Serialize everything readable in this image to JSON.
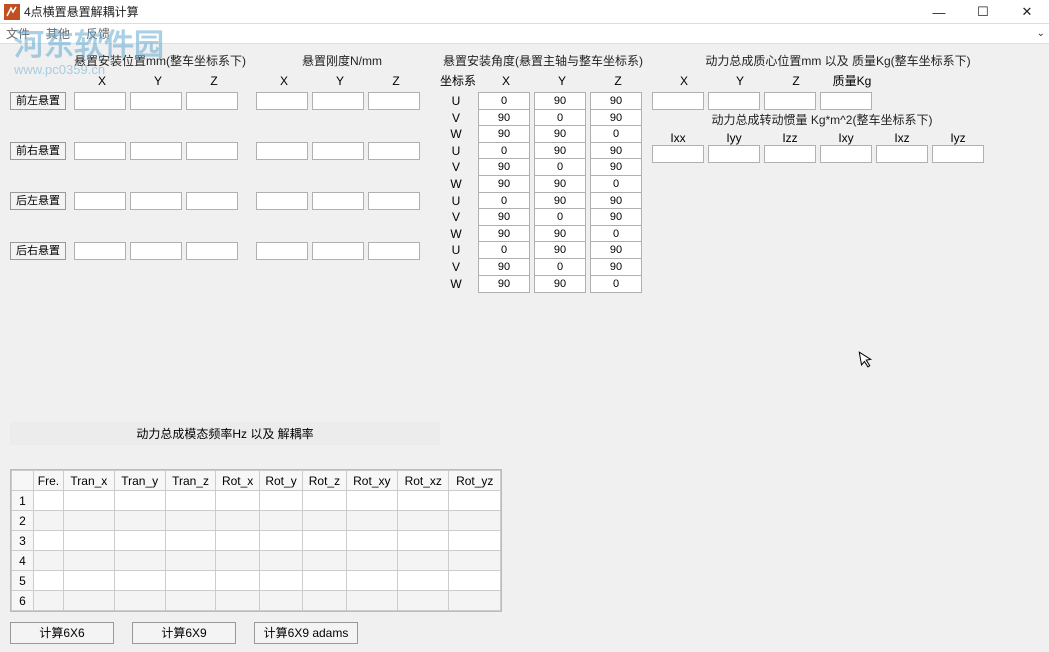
{
  "window": {
    "title": "4点横置悬置解耦计算",
    "min": "—",
    "max": "☐",
    "close": "✕"
  },
  "menu": {
    "file": "文件",
    "other": "其他",
    "feedback": "反馈"
  },
  "watermark": {
    "main": "河东软件园",
    "sub": "www.pc0359.cn"
  },
  "headers": {
    "pos": "悬置安装位置mm(整车坐标系下)",
    "stiff": "悬置刚度N/mm",
    "angle": "悬置安装角度(悬置主轴与整车坐标系)",
    "mass": "动力总成质心位置mm 以及 质量Kg(整车坐标系下)",
    "inertia": "动力总成转动惯量 Kg*m^2(整车坐标系下)"
  },
  "cols": {
    "X": "X",
    "Y": "Y",
    "Z": "Z",
    "coord": "坐标系",
    "massKg": "质量Kg",
    "Ixx": "Ixx",
    "Iyy": "Iyy",
    "Izz": "Izz",
    "Ixy": "Ixy",
    "Ixz": "Ixz",
    "Iyz": "Iyz"
  },
  "rowLabels": {
    "fl": "前左悬置",
    "fr": "前右悬置",
    "rl": "后左悬置",
    "rr": "后右悬置"
  },
  "uvw": {
    "U": "U",
    "V": "V",
    "W": "W"
  },
  "angles": [
    {
      "u": [
        "0",
        "90",
        "90"
      ],
      "v": [
        "90",
        "0",
        "90"
      ],
      "w": [
        "90",
        "90",
        "0"
      ]
    },
    {
      "u": [
        "0",
        "90",
        "90"
      ],
      "v": [
        "90",
        "0",
        "90"
      ],
      "w": [
        "90",
        "90",
        "0"
      ]
    },
    {
      "u": [
        "0",
        "90",
        "90"
      ],
      "v": [
        "90",
        "0",
        "90"
      ],
      "w": [
        "90",
        "90",
        "0"
      ]
    },
    {
      "u": [
        "0",
        "90",
        "90"
      ],
      "v": [
        "90",
        "0",
        "90"
      ],
      "w": [
        "90",
        "90",
        "0"
      ]
    }
  ],
  "freqTitle": "动力总成模态频率Hz 以及 解耦率",
  "table": {
    "headers": [
      "Fre.",
      "Tran_x",
      "Tran_y",
      "Tran_z",
      "Rot_x",
      "Rot_y",
      "Rot_z",
      "Rot_xy",
      "Rot_xz",
      "Rot_yz"
    ],
    "rows": [
      "1",
      "2",
      "3",
      "4",
      "5",
      "6"
    ]
  },
  "buttons": {
    "b1": "计算6X6",
    "b2": "计算6X9",
    "b3": "计算6X9 adams"
  }
}
